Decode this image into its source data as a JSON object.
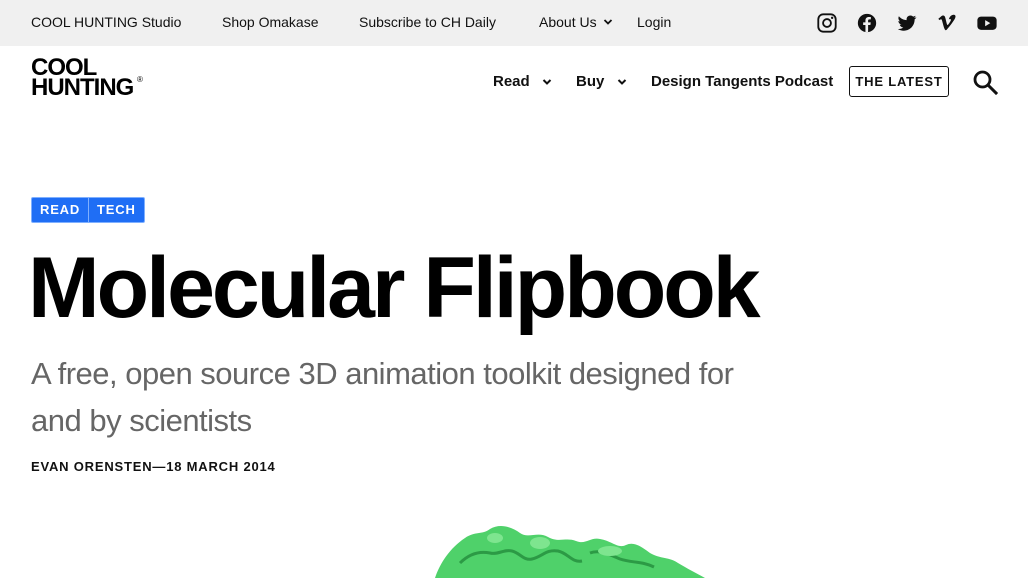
{
  "topbar": {
    "links": [
      {
        "label": "COOL HUNTING Studio"
      },
      {
        "label": "Shop Omakase"
      },
      {
        "label": "Subscribe to CH Daily"
      },
      {
        "label": "About Us"
      },
      {
        "label": "Login"
      }
    ],
    "social_icons": [
      "instagram-icon",
      "facebook-icon",
      "twitter-icon",
      "vimeo-icon",
      "youtube-icon"
    ]
  },
  "logo": {
    "line1": "COOL",
    "line2": "HUNTING",
    "mark": "®"
  },
  "nav": {
    "items": [
      {
        "label": "Read"
      },
      {
        "label": "Buy"
      },
      {
        "label": "Design Tangents Podcast"
      }
    ],
    "latest_label": "THE LATEST",
    "search_icon": "search-icon"
  },
  "article": {
    "tags": [
      "READ",
      "TECH"
    ],
    "title": "Molecular Flipbook",
    "subtitle": "A free, open source 3D animation toolkit designed for and by scientists",
    "byline": "EVAN ORENSTEN—18 MARCH 2014"
  },
  "colors": {
    "topbar_bg": "#f0f0f0",
    "tag_bg": "#1f6ef5",
    "subtitle": "#666666",
    "hero_green": "#4fd16a"
  }
}
